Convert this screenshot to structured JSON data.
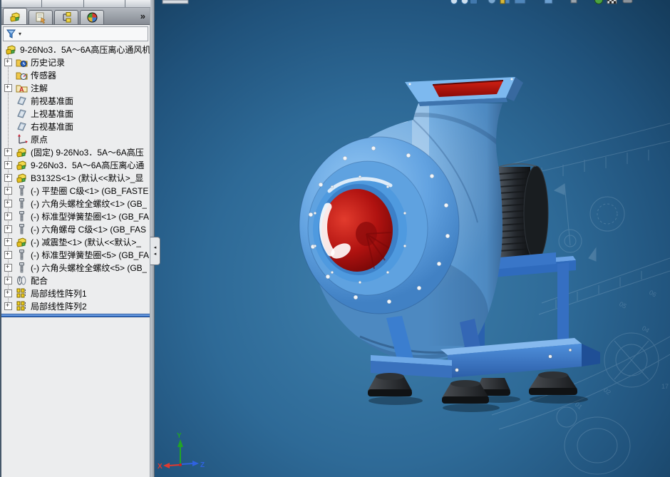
{
  "panel": {
    "tabs": [
      {
        "id": "featuremanager",
        "icon": "assembly-tree-icon",
        "active": true
      },
      {
        "id": "propertymanager",
        "icon": "property-hand-icon",
        "active": false
      },
      {
        "id": "configurationmanager",
        "icon": "configuration-icon",
        "active": false
      },
      {
        "id": "displaymanager",
        "icon": "display-sphere-icon",
        "active": false
      }
    ],
    "overflow_chevron": "»",
    "filter": {
      "icon": "filter-funnel-icon",
      "caret": "▾"
    }
  },
  "tree": {
    "items": [
      {
        "label": "9-26No3．5A～6A高压离心通风机",
        "icon": "assembly",
        "expand": false,
        "root": true
      },
      {
        "label": "历史记录",
        "icon": "folder-history",
        "expand": true
      },
      {
        "label": "传感器",
        "icon": "folder-sensor",
        "expand": false
      },
      {
        "label": "注解",
        "icon": "folder-annotation",
        "expand": true
      },
      {
        "label": "前视基准面",
        "icon": "plane",
        "expand": false
      },
      {
        "label": "上视基准面",
        "icon": "plane",
        "expand": false
      },
      {
        "label": "右视基准面",
        "icon": "plane",
        "expand": false
      },
      {
        "label": "原点",
        "icon": "origin",
        "expand": false
      },
      {
        "label": "(固定) 9-26No3．5A～6A高压",
        "icon": "assembly",
        "expand": true
      },
      {
        "label": "9-26No3．5A～6A高压离心通",
        "icon": "assembly",
        "expand": true
      },
      {
        "label": "B3132S<1> (默认<<默认>_显",
        "icon": "assembly",
        "expand": true
      },
      {
        "label": "(-) 平垫圈 C级<1> (GB_FASTE",
        "icon": "bolt",
        "expand": true
      },
      {
        "label": "(-) 六角头螺栓全螺纹<1> (GB_",
        "icon": "bolt",
        "expand": true
      },
      {
        "label": "(-) 标准型弹簧垫圈<1> (GB_FA",
        "icon": "bolt",
        "expand": true
      },
      {
        "label": "(-) 六角螺母 C级<1> (GB_FAS",
        "icon": "bolt",
        "expand": true
      },
      {
        "label": "(-) 减震垫<1> (默认<<默认>_",
        "icon": "assembly",
        "expand": true
      },
      {
        "label": "(-) 标准型弹簧垫圈<5> (GB_FA",
        "icon": "bolt",
        "expand": true
      },
      {
        "label": "(-) 六角头螺栓全螺纹<5> (GB_",
        "icon": "bolt",
        "expand": true
      },
      {
        "label": "配合",
        "icon": "mates",
        "expand": true
      },
      {
        "label": "局部线性阵列1",
        "icon": "pattern",
        "expand": true
      },
      {
        "label": "局部线性阵列2",
        "icon": "pattern",
        "expand": true
      }
    ]
  },
  "viewport": {
    "triad": {
      "x_label": "X",
      "y_label": "Y",
      "z_label": "Z",
      "x_color": "#e03a2f",
      "y_color": "#21a326",
      "z_color": "#2f62e0"
    },
    "headsup_icons": [
      "zoom-fit-icon",
      "zoom-area-icon",
      "previous-view-icon",
      "section-view-icon",
      "view-orientation-icon",
      "display-style-icon",
      "hide-show-icon",
      "appearance-icon",
      "scene-icon",
      "view-settings-icon"
    ],
    "flyout_arrows": "◂"
  },
  "colors": {
    "fan_body": "#5da0dc",
    "inlet_red": "#c41414",
    "frame_blue": "#3b7ed2",
    "motor_dark": "#23272b",
    "rollback_bar": "#2e6bc8",
    "background_center": "#3a78a6",
    "background_edge": "#173f5e"
  }
}
